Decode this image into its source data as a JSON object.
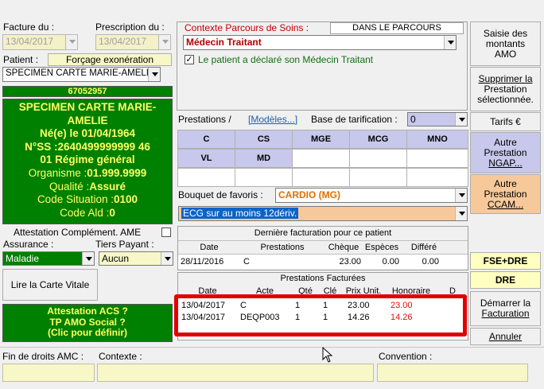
{
  "left": {
    "facture_label": "Facture du :",
    "facture_date": "13/04/2017",
    "prescription_label": "Prescription du :",
    "prescription_date": "13/04/2017",
    "patient_label": "Patient :",
    "forcage_btn": "Forçage exonération",
    "patient_value": "SPECIMEN CARTE MARIE-AMELIE",
    "patient_number": "67052957",
    "info": {
      "name1": "SPECIMEN CARTE MARIE-",
      "name2": "AMELIE",
      "birth": "Né(e) le 01/04/1964",
      "nss": "N°SS :2640499999999 46",
      "regime": "01 Régime général",
      "organisme_label": "Organisme :",
      "organisme_value": "01.999.9999",
      "qualite_label": "Qualité :",
      "qualite_value": "Assuré",
      "situation_label": "Code Situation :",
      "situation_value": "0100",
      "ald_label": "Code Ald :",
      "ald_value": "0"
    },
    "attestation_label": "Attestation Complément. AME",
    "assurance_label": "Assurance :",
    "assurance_value": "Maladie",
    "tiers_label": "Tiers Payant :",
    "tiers_value": "Aucun",
    "vitale_btn": "Lire la Carte Vitale",
    "acs1": "Attestation ACS ?",
    "acs2": "TP AMO Social ?",
    "acs3": "(Clic pour définir)"
  },
  "middle": {
    "contexte_label": "Contexte Parcours de Soins  :",
    "parcours_badge": "DANS LE PARCOURS",
    "medecin_value": "Médecin Traitant",
    "declare_label": "Le patient a déclaré son Médecin Traitant",
    "prestations_label": "Prestations /",
    "modeles_link": "[Modèles...]",
    "base_label": "Base de tarification :",
    "base_value": "0",
    "prest_row1": [
      "C",
      "CS",
      "MGE",
      "MCG",
      "MNO"
    ],
    "prest_row2": [
      "VL",
      "MD",
      "",
      "",
      ""
    ],
    "bouquet_label": "Bouquet de favoris :",
    "bouquet_value": "CARDIO (MG)",
    "favori_value": "ECG sur au moins 12dériv.",
    "derniere_title": "Dernière facturation pour ce patient",
    "derniere_cols": [
      "Date",
      "Prestations",
      "Chèque",
      "Espèces",
      "Différé"
    ],
    "derniere_row": [
      "28/11/2016",
      "C",
      "23.00",
      "0.00",
      "0.00"
    ],
    "facturees_title": "Prestations Facturées",
    "facturees_cols": [
      "Date",
      "Acte",
      "Qté",
      "Clé",
      "Prix Unit.",
      "Honoraire",
      "D"
    ],
    "facturees_rows": [
      {
        "date": "13/04/2017",
        "acte": "C",
        "q": "1",
        "k": "1",
        "prix": "23.00",
        "hon": "23.00"
      },
      {
        "date": "13/04/2017",
        "acte": "DEQP003",
        "q": "1",
        "k": "1",
        "prix": "14.26",
        "hon": "14.26"
      }
    ]
  },
  "right": {
    "saisie": [
      "Saisie des",
      "montants",
      "AMO"
    ],
    "supprimer": [
      "Supprimer la",
      "Prestation",
      "sélectionnée."
    ],
    "tarifs": "Tarifs €",
    "ngap": [
      "Autre",
      "Prestation",
      "NGAP..."
    ],
    "ccam": [
      "Autre",
      "Prestation",
      "CCAM..."
    ],
    "fse": "FSE+DRE",
    "dre": "DRE",
    "demarrer": [
      "Démarrer la",
      "Facturation"
    ],
    "annuler": "Annuler"
  },
  "bottom": {
    "fin_label": "Fin de droits AMC :",
    "contexte_label": "Contexte :",
    "convention_label": "Convention :"
  },
  "colors": {
    "green": "#008000",
    "yellow_text": "#ffff66",
    "highlight_red": "#e00000",
    "purple_btn": "#c8c8ec",
    "orange_btn": "#f7c99a"
  }
}
